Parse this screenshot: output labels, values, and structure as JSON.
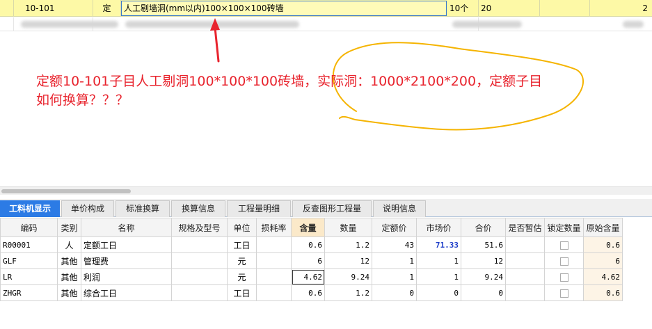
{
  "top_row": {
    "code": "10-101",
    "type": "定",
    "name": "人工剔墙洞(mm以内)100×100×100砖墙",
    "unit": "10个",
    "quantity": "20",
    "last": "2"
  },
  "annotation": {
    "line1": "定额10-101子目人工剔洞100*100*100砖墙，实际洞：1000*2100*200，定额子目",
    "line2": "如何换算？？？",
    "color": "#e8232d",
    "highlight_color": "#f5b400"
  },
  "tabs": [
    "工料机显示",
    "单价构成",
    "标准换算",
    "换算信息",
    "工程量明细",
    "反查图形工程量",
    "说明信息"
  ],
  "table": {
    "headers": [
      "编码",
      "类别",
      "名称",
      "规格及型号",
      "单位",
      "损耗率",
      "含量",
      "数量",
      "定额价",
      "市场价",
      "合价",
      "是否暂估",
      "锁定数量",
      "原始含量"
    ],
    "rows": [
      [
        "R00001",
        "人",
        "定额工日",
        "",
        "工日",
        "",
        "0.6",
        "1.2",
        "43",
        "71.33",
        "51.6",
        "",
        "",
        "0.6"
      ],
      [
        "GLF",
        "其他",
        "管理费",
        "",
        "元",
        "",
        "6",
        "12",
        "1",
        "1",
        "12",
        "",
        "",
        "6"
      ],
      [
        "LR",
        "其他",
        "利润",
        "",
        "元",
        "",
        "4.62",
        "9.24",
        "1",
        "1",
        "9.24",
        "",
        "",
        "4.62"
      ],
      [
        "ZHGR",
        "其他",
        "综合工日",
        "",
        "工日",
        "",
        "0.6",
        "1.2",
        "0",
        "0",
        "0",
        "",
        "",
        "0.6"
      ]
    ]
  }
}
